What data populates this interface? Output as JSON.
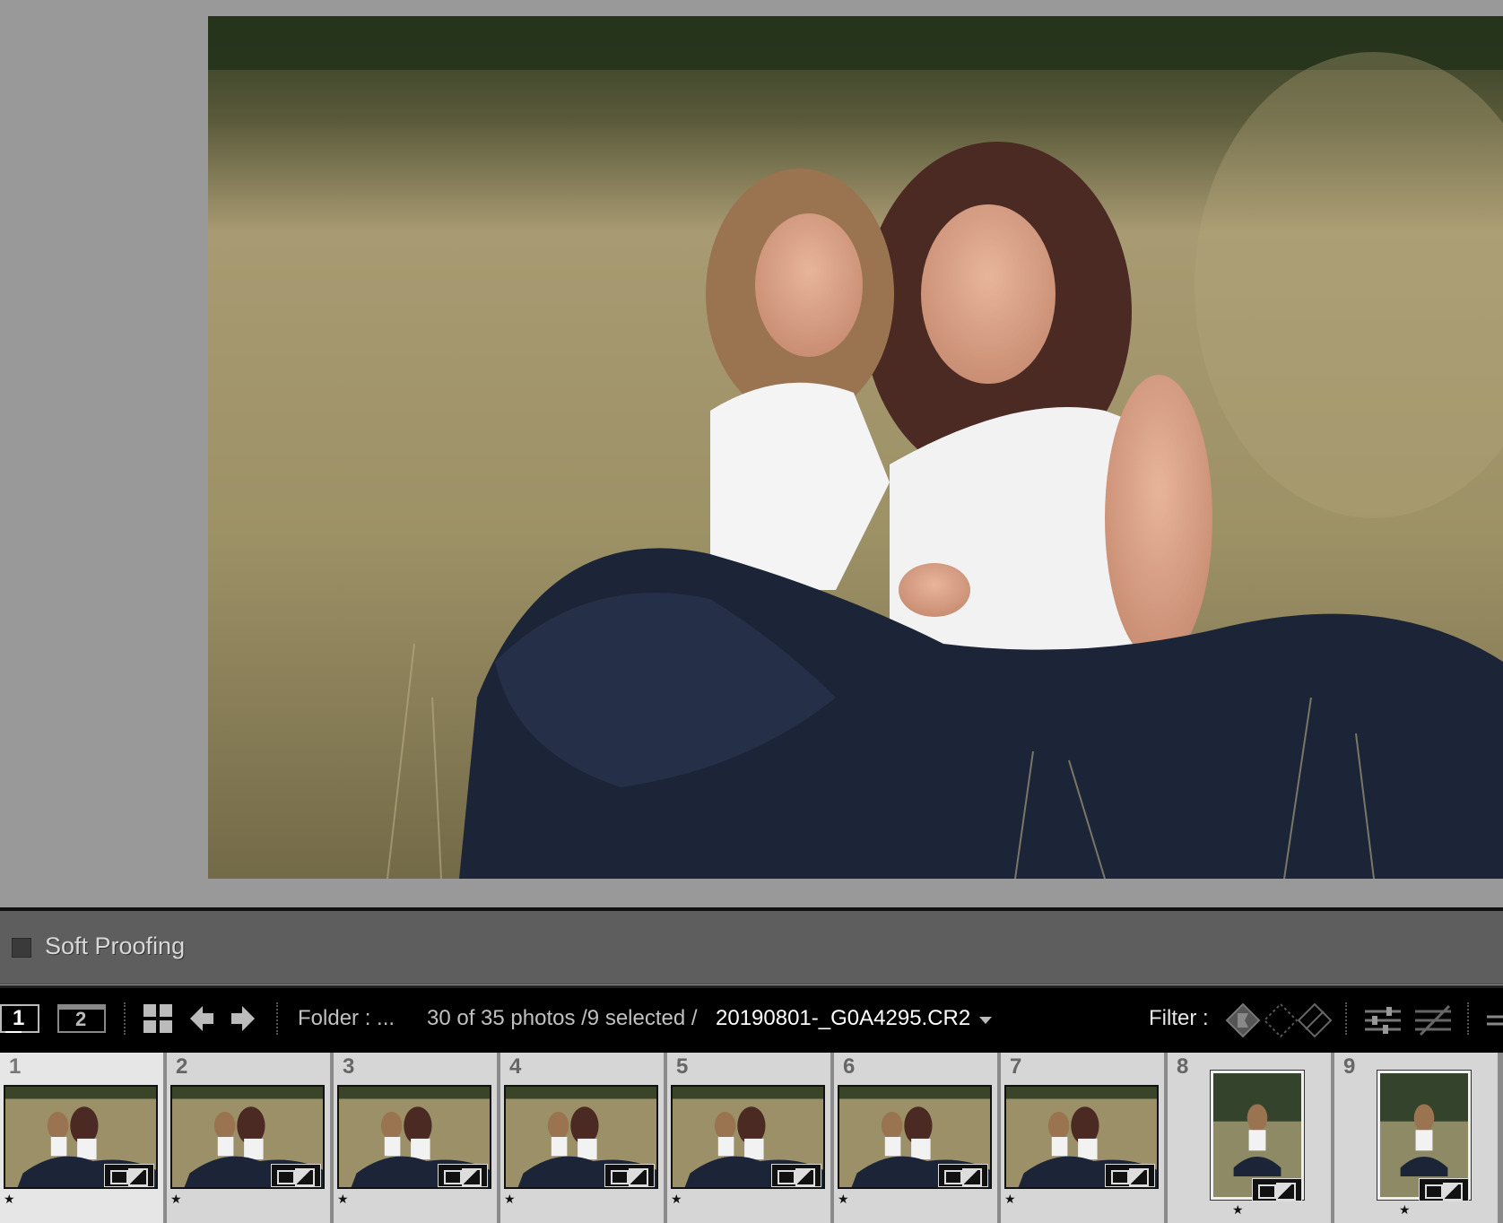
{
  "toolbar": {
    "soft_proofing_label": "Soft Proofing"
  },
  "filmstrip_header": {
    "view1_label": "1",
    "view2_label": "2",
    "source_label": "Folder : ...",
    "photo_count": "30 of 35 photos /9 selected /",
    "current_file": "20190801-_G0A4295.CR2",
    "filter_label": "Filter :"
  },
  "filmstrip": {
    "items": [
      {
        "number": "1",
        "rating": "★",
        "orientation": "landscape",
        "state": "active"
      },
      {
        "number": "2",
        "rating": "★",
        "orientation": "landscape",
        "state": "selected"
      },
      {
        "number": "3",
        "rating": "★",
        "orientation": "landscape",
        "state": "selected"
      },
      {
        "number": "4",
        "rating": "★",
        "orientation": "landscape",
        "state": "selected"
      },
      {
        "number": "5",
        "rating": "★",
        "orientation": "landscape",
        "state": "selected"
      },
      {
        "number": "6",
        "rating": "★",
        "orientation": "landscape",
        "state": "selected"
      },
      {
        "number": "7",
        "rating": "★",
        "orientation": "landscape",
        "state": "selected"
      },
      {
        "number": "8",
        "rating": "★",
        "orientation": "portrait",
        "state": "selected"
      },
      {
        "number": "9",
        "rating": "★",
        "orientation": "portrait",
        "state": "selected"
      }
    ]
  },
  "icons": {
    "grid": "grid-view-icon",
    "prev": "arrow-left-icon",
    "next": "arrow-right-icon",
    "flag_filters": [
      "flagged-filter-icon",
      "unflagged-filter-icon",
      "rejected-filter-icon"
    ],
    "edit_filters": [
      "edited-filter-icon",
      "unedited-filter-icon"
    ],
    "badges": "edit-badge-icon"
  },
  "colors": {
    "background": "#999999",
    "header": "#000000",
    "proof_bar": "#5e5e5e"
  }
}
